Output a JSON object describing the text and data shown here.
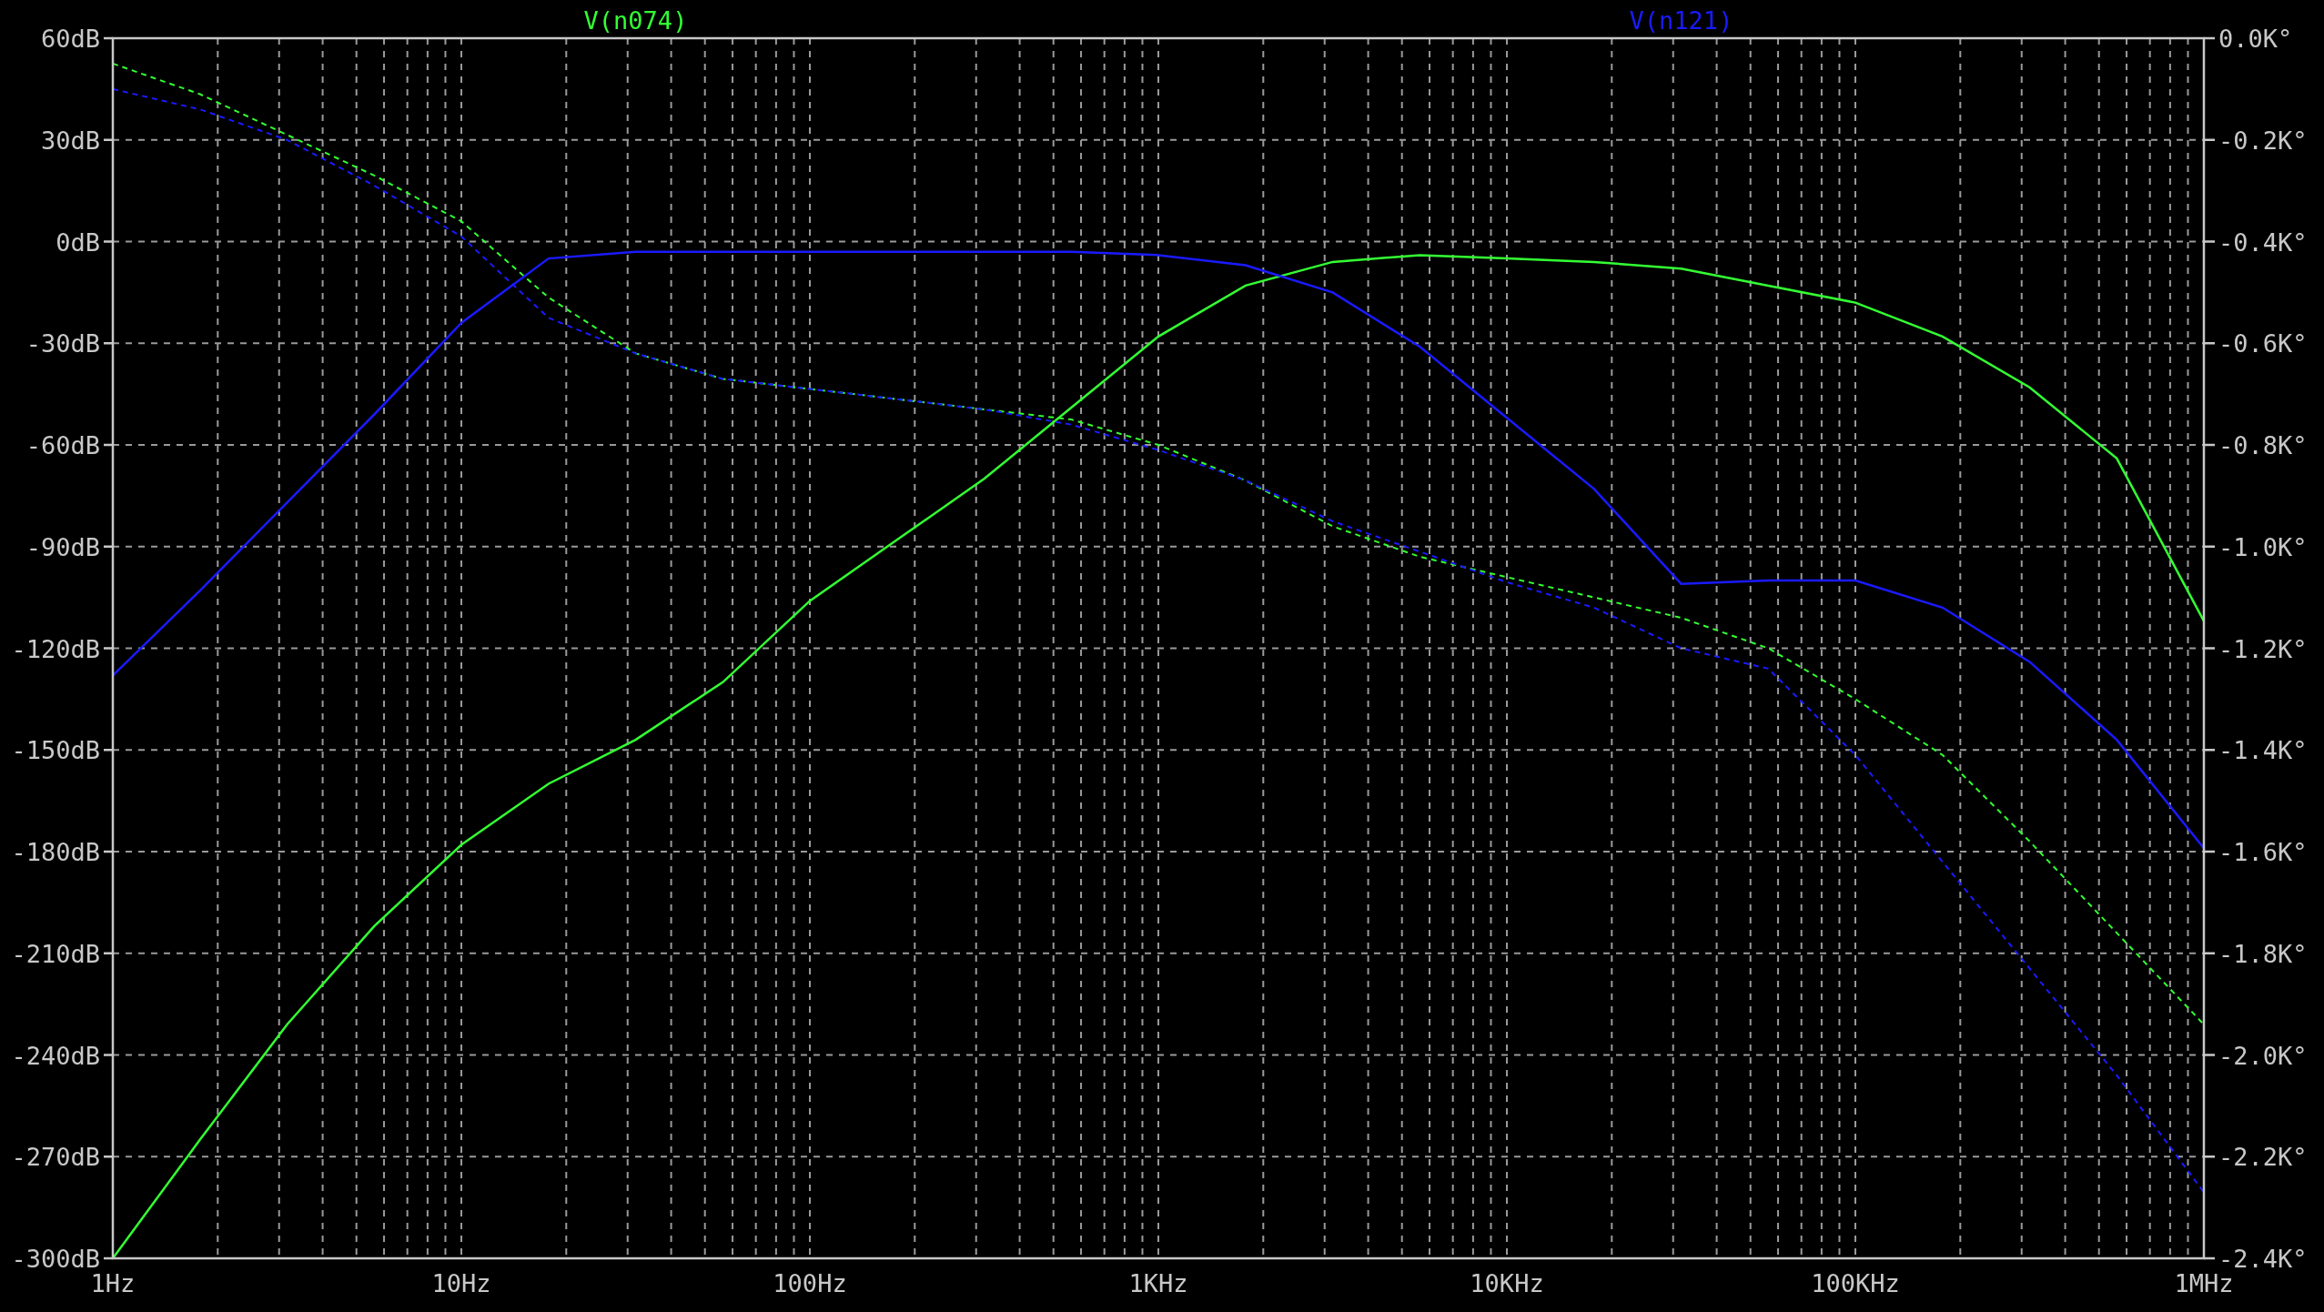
{
  "plot": {
    "chart_data": {
      "type": "line",
      "grid": true,
      "categories": [
        "1Hz",
        null,
        null,
        null,
        "10Hz",
        null,
        null,
        null,
        "100Hz",
        null,
        null,
        null,
        "1KHz",
        null,
        null,
        null,
        "10KHz",
        null,
        null,
        null,
        "100KHz",
        null,
        null,
        null,
        "1MHz"
      ],
      "ylim": [
        -300,
        60
      ],
      "y2lim": [
        -2.4,
        0
      ],
      "yticks": [
        {
          "value": 60,
          "label": "60dB"
        },
        {
          "value": 30,
          "label": "30dB"
        },
        {
          "value": 0,
          "label": "0dB"
        },
        {
          "value": -30,
          "label": "-30dB"
        },
        {
          "value": -60,
          "label": "-60dB"
        },
        {
          "value": -90,
          "label": "-90dB"
        },
        {
          "value": -120,
          "label": "-120dB"
        },
        {
          "value": -150,
          "label": "-150dB"
        },
        {
          "value": -180,
          "label": "-180dB"
        },
        {
          "value": -210,
          "label": "-210dB"
        },
        {
          "value": -240,
          "label": "-240dB"
        },
        {
          "value": -270,
          "label": "-270dB"
        },
        {
          "value": -300,
          "label": "-300dB"
        }
      ],
      "y2ticks": [
        {
          "value": 0,
          "label": "0.0K°"
        },
        {
          "value": -0.2,
          "label": "-0.2K°"
        },
        {
          "value": -0.4,
          "label": "-0.4K°"
        },
        {
          "value": -0.6,
          "label": "-0.6K°"
        },
        {
          "value": -0.8,
          "label": "-0.8K°"
        },
        {
          "value": -1.0,
          "label": "-1.0K°"
        },
        {
          "value": -1.2,
          "label": "-1.2K°"
        },
        {
          "value": -1.4,
          "label": "-1.4K°"
        },
        {
          "value": -1.6,
          "label": "-1.6K°"
        },
        {
          "value": -1.8,
          "label": "-1.8K°"
        },
        {
          "value": -2.0,
          "label": "-2.0K°"
        },
        {
          "value": -2.2,
          "label": "-2.2K°"
        },
        {
          "value": -2.4,
          "label": "-2.4K°"
        }
      ],
      "series": [
        {
          "name": "V(n074)",
          "color": "#33ff33",
          "line_style": "solid",
          "values": [
            -300,
            -265,
            -231,
            -202,
            -178,
            -160,
            -147,
            -130,
            -106,
            -88,
            -70,
            -49,
            -28,
            -13,
            -6,
            -4,
            -5,
            -6,
            -8,
            -13,
            -18,
            -28,
            -43,
            -64,
            -112
          ]
        },
        {
          "color": "#33ff33",
          "axis": "y2",
          "line_style": "dashed",
          "values": [
            -0.05,
            -0.11,
            -0.19,
            -0.27,
            -0.36,
            -0.51,
            -0.62,
            -0.67,
            -0.69,
            -0.71,
            -0.73,
            -0.75,
            -0.8,
            -0.87,
            -0.96,
            -1.02,
            -1.06,
            -1.1,
            -1.14,
            -1.2,
            -1.3,
            -1.41,
            -1.58,
            -1.76,
            -1.94
          ]
        },
        {
          "name": "V(n121)",
          "color": "#1a1aff",
          "line_style": "solid",
          "values": [
            -128,
            -103,
            -77,
            -51,
            -24,
            -5,
            -3,
            -3,
            -3,
            -3,
            -3,
            -3,
            -4,
            -7,
            -15,
            -31,
            -52,
            -73,
            -101,
            -100,
            -100,
            -108,
            -124,
            -147,
            -179
          ]
        },
        {
          "color": "#1a1aff",
          "axis": "y2",
          "line_style": "dashed",
          "values": [
            -0.1,
            -0.14,
            -0.2,
            -0.29,
            -0.39,
            -0.55,
            -0.62,
            -0.67,
            -0.69,
            -0.71,
            -0.73,
            -0.76,
            -0.81,
            -0.87,
            -0.95,
            -1.01,
            -1.07,
            -1.12,
            -1.2,
            -1.24,
            -1.41,
            -1.62,
            -1.83,
            -2.04,
            -2.27
          ]
        }
      ]
    }
  }
}
